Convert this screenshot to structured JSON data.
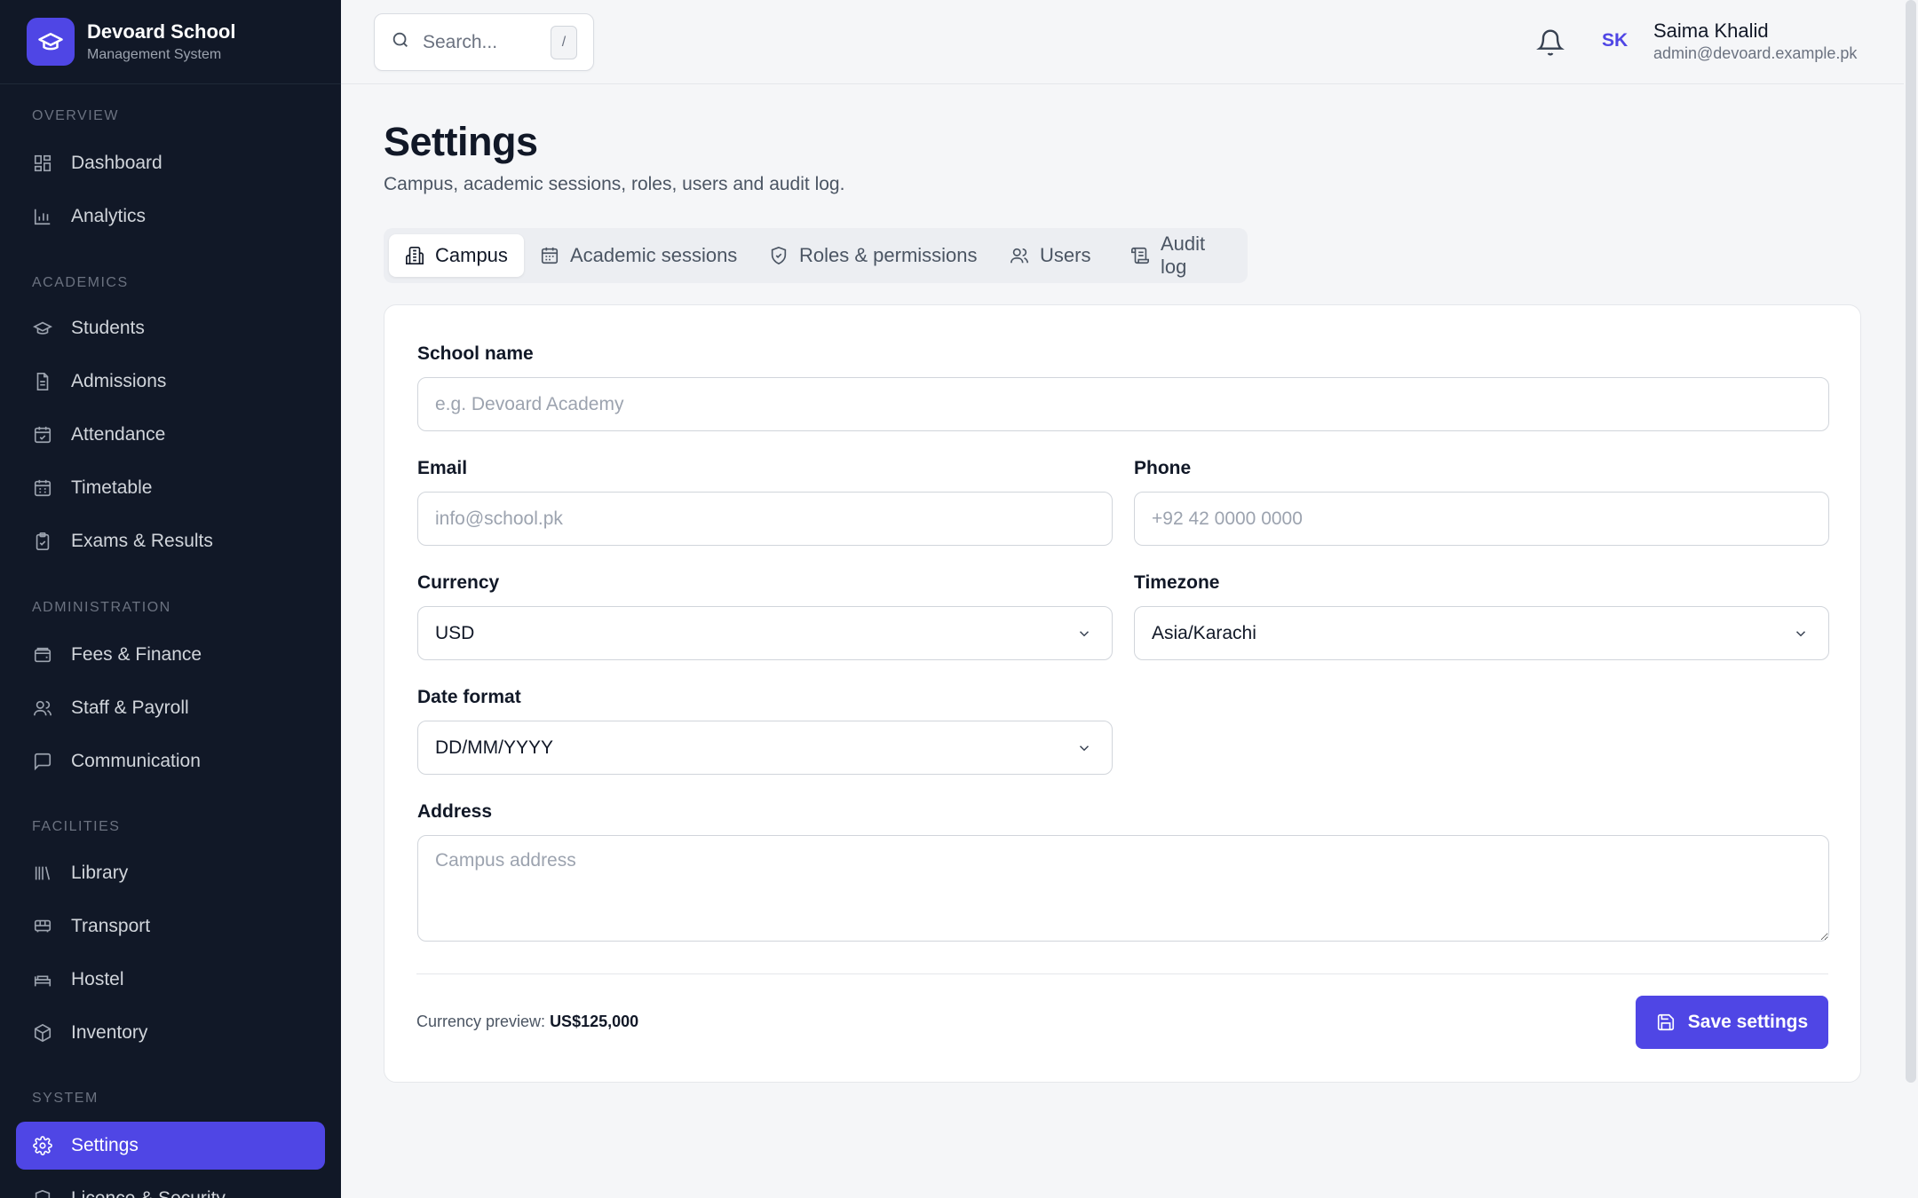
{
  "brand": {
    "name": "Devoard School",
    "subtitle": "Management System"
  },
  "sidebar": {
    "sections": [
      "OVERVIEW",
      "ACADEMICS",
      "ADMINISTRATION",
      "FACILITIES",
      "SYSTEM"
    ],
    "items": [
      {
        "label": "Dashboard",
        "icon": "grid-icon"
      },
      {
        "label": "Analytics",
        "icon": "bar-chart-icon"
      },
      {
        "label": "Students",
        "icon": "graduation-cap-icon"
      },
      {
        "label": "Admissions",
        "icon": "document-icon"
      },
      {
        "label": "Attendance",
        "icon": "calendar-check-icon"
      },
      {
        "label": "Timetable",
        "icon": "calendar-grid-icon"
      },
      {
        "label": "Exams & Results",
        "icon": "clipboard-icon"
      },
      {
        "label": "Fees & Finance",
        "icon": "wallet-icon"
      },
      {
        "label": "Staff & Payroll",
        "icon": "users-icon"
      },
      {
        "label": "Communication",
        "icon": "message-icon"
      },
      {
        "label": "Library",
        "icon": "library-icon"
      },
      {
        "label": "Transport",
        "icon": "bus-icon"
      },
      {
        "label": "Hostel",
        "icon": "bed-icon"
      },
      {
        "label": "Inventory",
        "icon": "package-icon"
      },
      {
        "label": "Settings",
        "icon": "gear-icon",
        "active": true
      },
      {
        "label": "Licence & Security",
        "icon": "shield-icon"
      }
    ]
  },
  "topbar": {
    "search_placeholder": "Search...",
    "search_shortcut": "/",
    "user": {
      "initials": "SK",
      "name": "Saima Khalid",
      "email": "admin@devoard.example.pk"
    }
  },
  "page": {
    "title": "Settings",
    "subtitle": "Campus, academic sessions, roles, users and audit log."
  },
  "tabs": [
    {
      "label": "Campus",
      "icon": "building-icon",
      "active": true
    },
    {
      "label": "Academic sessions",
      "icon": "calendar-icon"
    },
    {
      "label": "Roles & permissions",
      "icon": "shield-check-icon"
    },
    {
      "label": "Users",
      "icon": "users-icon"
    },
    {
      "label": "Audit log",
      "icon": "scroll-icon"
    }
  ],
  "form": {
    "school_name": {
      "label": "School name",
      "placeholder": "e.g. Devoard Academy",
      "value": ""
    },
    "email": {
      "label": "Email",
      "placeholder": "info@school.pk",
      "value": ""
    },
    "phone": {
      "label": "Phone",
      "placeholder": "+92 42 0000 0000",
      "value": ""
    },
    "currency": {
      "label": "Currency",
      "value": "USD"
    },
    "timezone": {
      "label": "Timezone",
      "value": "Asia/Karachi"
    },
    "date_format": {
      "label": "Date format",
      "value": "DD/MM/YYYY"
    },
    "address": {
      "label": "Address",
      "placeholder": "Campus address",
      "value": ""
    },
    "currency_preview_label": "Currency preview:",
    "currency_preview_value": "US$125,000",
    "save_label": "Save settings"
  },
  "colors": {
    "accent": "#4f46e5",
    "sidebar_bg": "#111827",
    "page_bg": "#f5f6f8"
  }
}
